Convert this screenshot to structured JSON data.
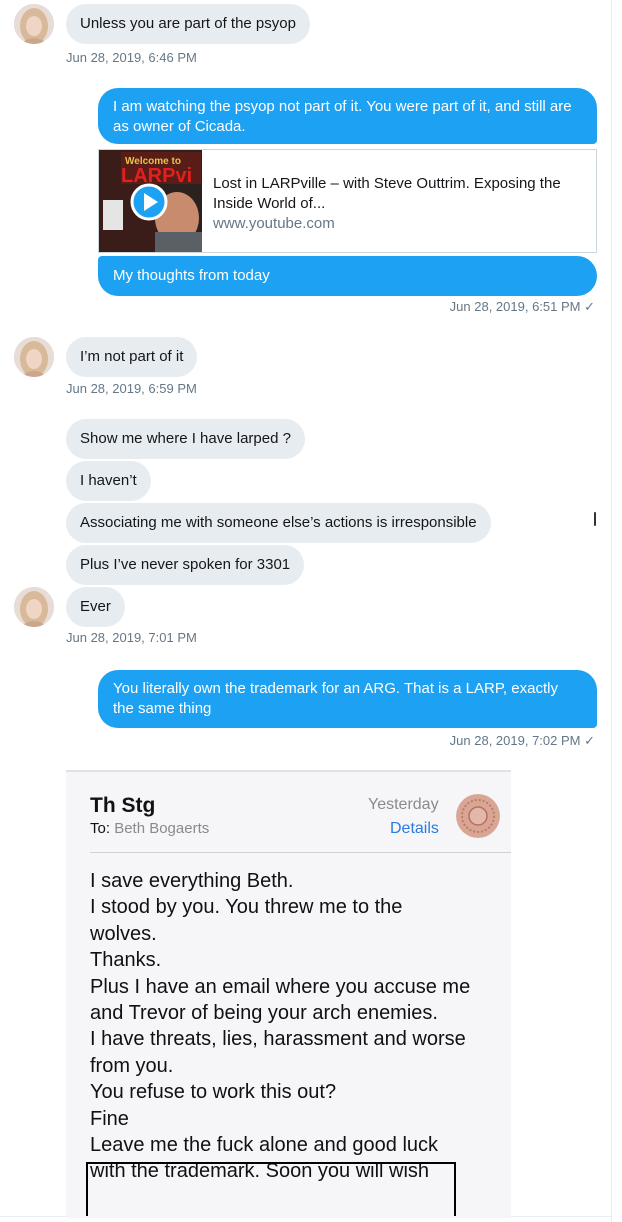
{
  "messages": {
    "m1_text": "Unless you are part of the psyop",
    "m1_time": "Jun 28, 2019, 6:46 PM",
    "m2_text": "I am watching the psyop not part of it. You were part of it, and still are as owner of Cicada.",
    "card": {
      "thumb_text_1": "Welcome to",
      "thumb_text_2": "LARPvi",
      "title": "Lost in LARPville – with Steve Outtrim. Exposing the Inside World of...",
      "domain": "www.youtube.com"
    },
    "m3_text": "My thoughts from today",
    "m3_time": "Jun 28, 2019, 6:51 PM ✓",
    "m4_text": "I’m not part of it",
    "m4_time": "Jun 28, 2019, 6:59 PM",
    "m5_text": "Show me where I have larped ?",
    "m6_text": "I haven’t",
    "m7_text": "Associating me with someone else’s actions is irresponsible",
    "m8_text": "Plus I’ve never spoken for 3301",
    "m9_text": "Ever",
    "m9_time": "Jun 28, 2019, 7:01 PM",
    "m10_text": "You literally own the trademark for an ARG. That is a LARP, exactly the same thing",
    "m10_time": "Jun 28, 2019, 7:02 PM ✓"
  },
  "email": {
    "from": "Th Stg",
    "to_label": "To:",
    "to_name": "Beth Bogaerts",
    "date": "Yesterday",
    "details_label": "Details",
    "body_lines": [
      "I save everything Beth.",
      "I stood by you. You threw me to the",
      "wolves.",
      "Thanks.",
      "Plus I have an email where you accuse me",
      "and Trevor of being your arch enemies.",
      "I have threats, lies, harassment and worse",
      "from you.",
      "You refuse to work this out?",
      "Fine",
      "Leave me the fuck alone and good luck",
      "with the trademark. Soon you will wish"
    ]
  },
  "colors": {
    "outgoing_bubble": "#1da1f2",
    "incoming_bubble": "#e6ecf0",
    "timestamp": "#657786",
    "details_link": "#2a7ae2"
  }
}
